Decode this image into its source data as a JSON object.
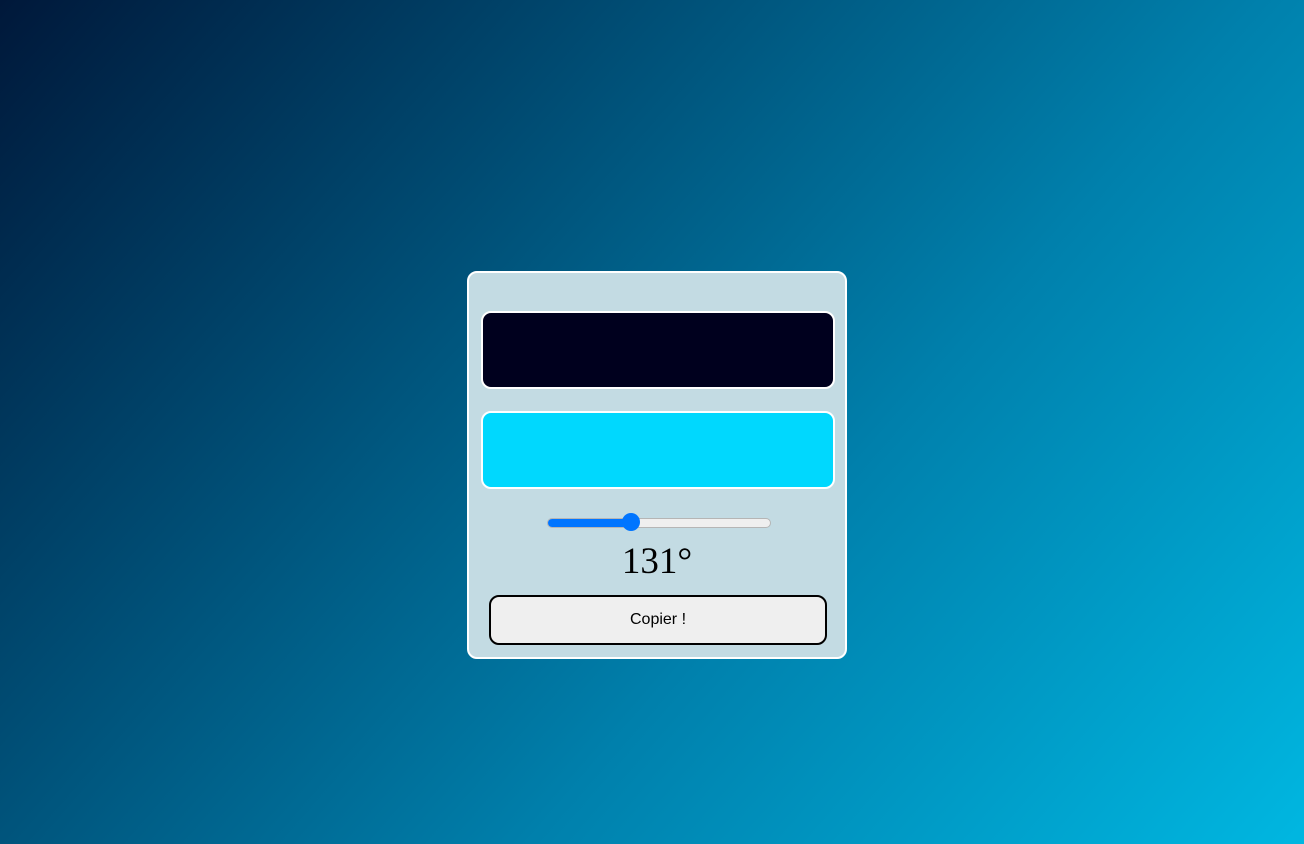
{
  "colors": {
    "first": "#00001e",
    "second": "#00d8fe",
    "card_background": "#c3dbe3",
    "slider_accent": "#0075ff"
  },
  "angle": {
    "value": 131,
    "min": 0,
    "max": 360,
    "label": "131°"
  },
  "copy_button": {
    "label": "Copier !"
  }
}
